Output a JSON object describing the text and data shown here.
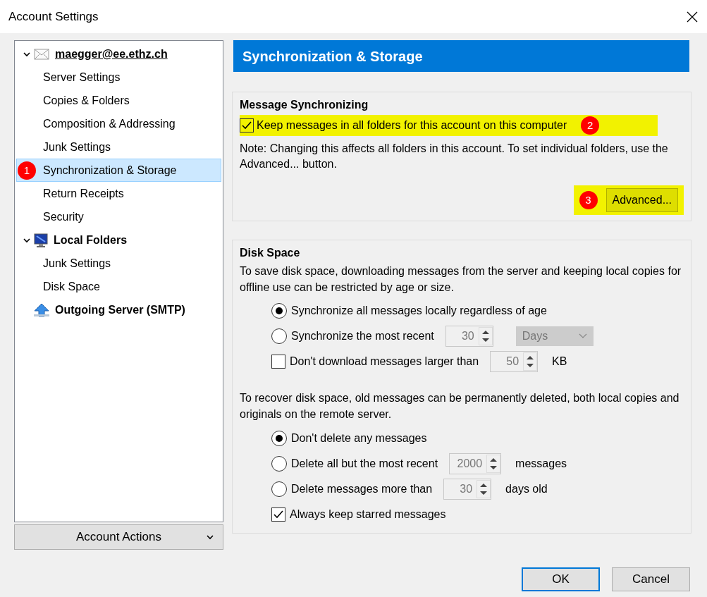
{
  "window": {
    "title": "Account Settings"
  },
  "tree": [
    {
      "label": "maegger@ee.ethz.ch",
      "kind": "mail",
      "expanded": true,
      "focused": true,
      "selected": false,
      "children": [
        {
          "label": "Server Settings",
          "selected": false
        },
        {
          "label": "Copies & Folders",
          "selected": false
        },
        {
          "label": "Composition & Addressing",
          "selected": false
        },
        {
          "label": "Junk Settings",
          "selected": false
        },
        {
          "label": "Synchronization & Storage",
          "selected": true,
          "callout": "1"
        },
        {
          "label": "Return Receipts",
          "selected": false
        },
        {
          "label": "Security",
          "selected": false
        }
      ]
    },
    {
      "label": "Local Folders",
      "kind": "monitor",
      "expanded": true,
      "focused": false,
      "selected": false,
      "children": [
        {
          "label": "Junk Settings",
          "selected": false
        },
        {
          "label": "Disk Space",
          "selected": false
        }
      ]
    },
    {
      "label": "Outgoing Server (SMTP)",
      "kind": "upload",
      "focused": false,
      "selected": false
    }
  ],
  "account_actions": {
    "label": "Account Actions"
  },
  "page_title": "Synchronization & Storage",
  "sync": {
    "heading": "Message Synchronizing",
    "checkbox": {
      "label": "Keep messages in all folders for this account on this computer",
      "checked": true,
      "highlighted": true,
      "callout": "2"
    },
    "note": "Note: Changing this affects all folders in this account. To set individual folders, use the Advanced... button.",
    "button": {
      "label": "Advanced...",
      "highlighted": true,
      "callout": "3"
    }
  },
  "disk": {
    "heading": "Disk Space",
    "intro": "To save disk space, downloading messages from the server and keeping local copies for offline use can be restricted by age or size.",
    "options": [
      {
        "kind": "radio",
        "label": "Synchronize all messages locally regardless of age",
        "selected": true
      },
      {
        "kind": "radio",
        "label": "Synchronize the most recent",
        "selected": false,
        "spin": {
          "value": "30",
          "disabled": true
        },
        "dropdown": {
          "value": "Days",
          "disabled": true
        }
      },
      {
        "kind": "checkbox",
        "label": "Don't download messages larger than",
        "checked": false,
        "spin": {
          "value": "50",
          "disabled": true
        },
        "suffix": "KB"
      }
    ],
    "recover_intro": "To recover disk space, old messages can be permanently deleted, both local copies and originals on the remote server.",
    "delete_options": [
      {
        "kind": "radio",
        "label": "Don't delete any messages",
        "selected": true
      },
      {
        "kind": "radio",
        "label": "Delete all but the most recent",
        "selected": false,
        "spin": {
          "value": "2000",
          "disabled": true
        },
        "suffix": "messages"
      },
      {
        "kind": "radio",
        "label": "Delete messages more than",
        "selected": false,
        "spin": {
          "value": "30",
          "disabled": true
        },
        "suffix": "days old"
      },
      {
        "kind": "checkbox",
        "label": "Always keep starred messages",
        "checked": true
      }
    ]
  },
  "buttons": [
    {
      "label": "OK",
      "default": true
    },
    {
      "label": "Cancel",
      "default": false
    }
  ]
}
